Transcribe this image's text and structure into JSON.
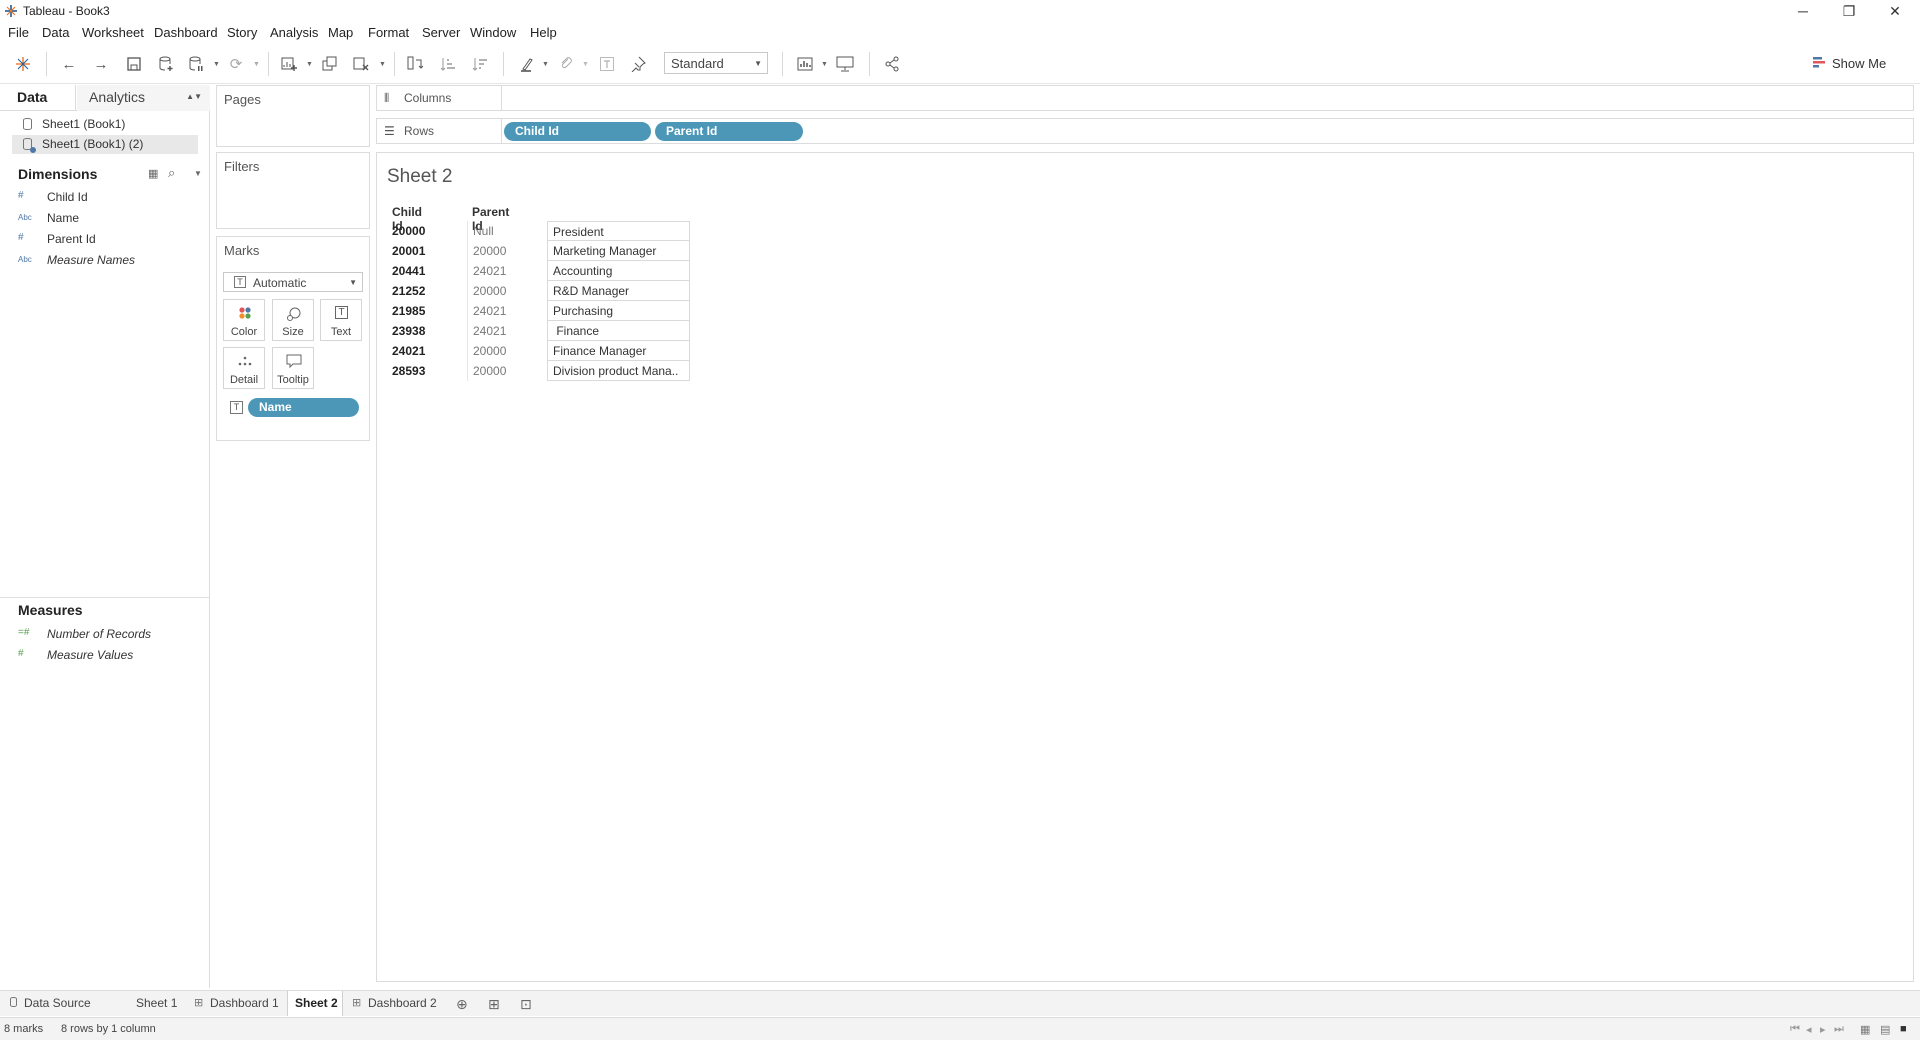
{
  "window": {
    "title": "Tableau - Book3",
    "minimize_glyph": "─",
    "restore_glyph": "❐",
    "close_glyph": "✕"
  },
  "menu": [
    "File",
    "Data",
    "Worksheet",
    "Dashboard",
    "Story",
    "Analysis",
    "Map",
    "Format",
    "Server",
    "Window",
    "Help"
  ],
  "toolbar": {
    "fit_value": "Standard",
    "show_me_label": "Show Me"
  },
  "data_pane": {
    "tab_data": "Data",
    "tab_analytics": "Analytics",
    "data_sources": [
      "Sheet1 (Book1)",
      "Sheet1 (Book1) (2)"
    ],
    "dimensions_title": "Dimensions",
    "dimensions": [
      {
        "type": "#",
        "name": "Child Id"
      },
      {
        "type": "Abc",
        "name": "Name"
      },
      {
        "type": "#",
        "name": "Parent Id"
      },
      {
        "type": "Abc",
        "name": "Measure Names"
      }
    ],
    "measures_title": "Measures",
    "measures": [
      {
        "type": "=#",
        "name": "Number of Records"
      },
      {
        "type": "#",
        "name": "Measure Values"
      }
    ]
  },
  "cards": {
    "pages": "Pages",
    "filters": "Filters",
    "marks": "Marks",
    "marks_type": "Automatic",
    "mark_buttons": [
      "Color",
      "Size",
      "Text",
      "Detail",
      "Tooltip"
    ],
    "text_pill": "Name"
  },
  "shelves": {
    "columns_label": "Columns",
    "rows_label": "Rows",
    "row_pills": [
      "Child Id",
      "Parent Id"
    ]
  },
  "view": {
    "sheet_title": "Sheet 2",
    "headers": [
      "Child Id",
      "Parent Id"
    ],
    "rows": [
      [
        "20000",
        "Null",
        "President"
      ],
      [
        "20001",
        "20000",
        "Marketing Manager"
      ],
      [
        "20441",
        "24021",
        "Accounting"
      ],
      [
        "21252",
        "20000",
        "R&D Manager"
      ],
      [
        "21985",
        "24021",
        "Purchasing"
      ],
      [
        "23938",
        "24021",
        " Finance"
      ],
      [
        "24021",
        "20000",
        "Finance Manager"
      ],
      [
        "28593",
        "20000",
        "Division product Mana.."
      ]
    ]
  },
  "tabs": [
    "Data Source",
    "Sheet 1",
    "Dashboard 1",
    "Sheet 2",
    "Dashboard 2"
  ],
  "active_tab": "Sheet 2",
  "status": {
    "marks": "8 marks",
    "dims": "8 rows by 1 column"
  },
  "colors": {
    "pill": "#4c97b8",
    "dimension_icon": "#4e79a7",
    "measure_icon": "#59a14f"
  }
}
